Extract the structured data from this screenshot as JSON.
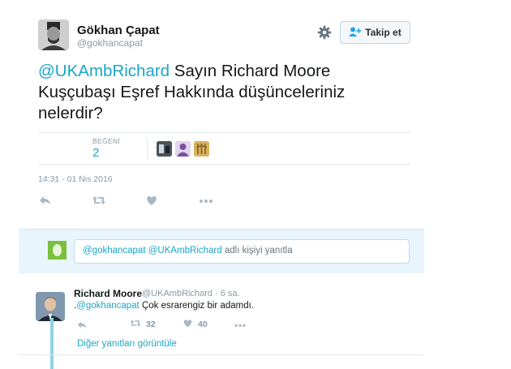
{
  "tweet": {
    "author_name": "Gökhan Çapat",
    "author_handle": "@gokhancapat",
    "follow_label": "Takip et",
    "text_mention": "@UKAmbRichard",
    "text_body": " Sayın Richard Moore Kuşçubaşı Eşref Hakkında düşünceleriniz nelerdir?",
    "likes_label": "BEĞENİ",
    "likes_count": "2",
    "timestamp": "14:31 - 01 Nis 2016",
    "actions": [
      "reply-icon",
      "retweet-icon",
      "like-icon",
      "more-icon"
    ]
  },
  "reply_box": {
    "mention1": "@gokhancapat",
    "mention2": "@UKAmbRichard",
    "suffix": " adlı kişiyi yanıtla"
  },
  "reply": {
    "author_name": "Richard Moore",
    "author_handle": "@UKAmbRichard · 6 sa.",
    "text_prefix": ".",
    "text_mention": "@gokhancapat",
    "text_body": " Çok esrarengiz bir adamdı.",
    "retweets": "32",
    "likes": "40",
    "more_replies": "Diğer yanıtları görüntüle"
  },
  "colors": {
    "accent": "#1aa6c8",
    "muted": "#8899a6",
    "reply_bg": "#e8f5fb"
  }
}
